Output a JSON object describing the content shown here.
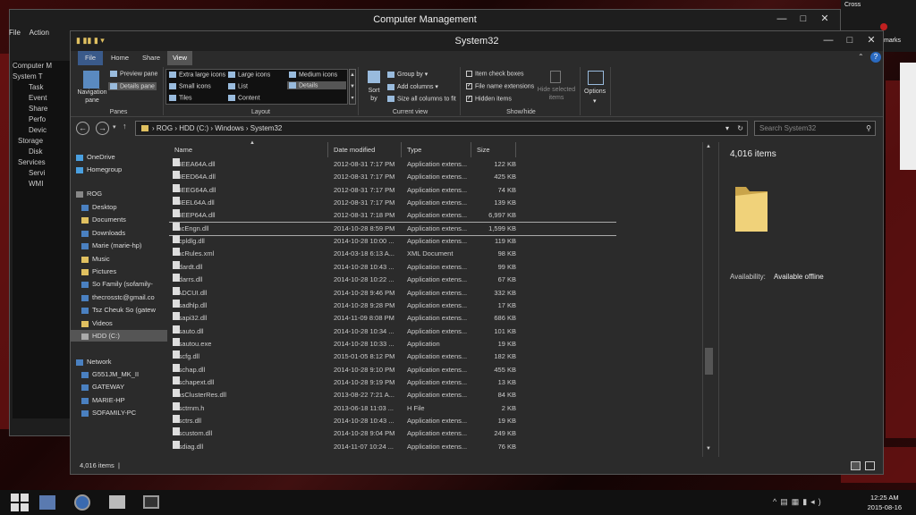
{
  "cm_window": {
    "title": "Computer Management",
    "menu": [
      "File",
      "Action"
    ],
    "tree": [
      "Computer M",
      "System T",
      "Task",
      "Event",
      "Share",
      "Perfo",
      "Devic",
      "Storage",
      "Disk",
      "Services",
      "Servi",
      "WMI"
    ]
  },
  "corner": {
    "top": "Cross",
    "bottom": "marks"
  },
  "explorer": {
    "title": "System32",
    "tabs": [
      "File",
      "Home",
      "Share",
      "View"
    ],
    "ribbon": {
      "panes": {
        "navigation_pane": "Navigation pane",
        "preview_pane": "Preview pane",
        "details_pane": "Details pane",
        "label": "Panes"
      },
      "layout": {
        "options": [
          "Extra large icons",
          "Large icons",
          "Medium icons",
          "Small icons",
          "List",
          "Details",
          "Tiles",
          "Content"
        ],
        "label": "Layout"
      },
      "current_view": {
        "sort_by": "Sort by",
        "group_by": "Group by",
        "add_columns": "Add columns",
        "size_all": "Size all columns to fit",
        "label": "Current view"
      },
      "show_hide": {
        "item_check_boxes": "Item check boxes",
        "file_name_extensions": "File name extensions",
        "hidden_items": "Hidden items",
        "hide_selected": "Hide selected items",
        "label": "Show/hide"
      },
      "options_label": "Options"
    },
    "address": {
      "crumbs": [
        "ROG",
        "HDD (C:)",
        "Windows",
        "System32"
      ],
      "search_placeholder": "Search System32"
    },
    "nav": [
      {
        "label": "OneDrive",
        "color": "#4aa0e0"
      },
      {
        "label": "Homegroup",
        "color": "#4aa0e0"
      },
      {
        "label": "ROG",
        "color": "#888"
      },
      {
        "label": "Desktop",
        "color": "#4a80c0"
      },
      {
        "label": "Documents",
        "color": "#e0c060"
      },
      {
        "label": "Downloads",
        "color": "#4a80c0"
      },
      {
        "label": "Marie (marie-hp)",
        "color": "#4a80c0"
      },
      {
        "label": "Music",
        "color": "#e0c060"
      },
      {
        "label": "Pictures",
        "color": "#e0c060"
      },
      {
        "label": "So Family (sofamily-",
        "color": "#4a80c0"
      },
      {
        "label": "thecrosstc@gmail.co",
        "color": "#4a80c0"
      },
      {
        "label": "Tsz Cheuk So (gatew",
        "color": "#4a80c0"
      },
      {
        "label": "Videos",
        "color": "#e0c060"
      },
      {
        "label": "HDD (C:)",
        "color": "#aaa"
      },
      {
        "label": "Network",
        "color": "#4a80c0"
      },
      {
        "label": "G551JM_MK_II",
        "color": "#4a80c0"
      },
      {
        "label": "GATEWAY",
        "color": "#4a80c0"
      },
      {
        "label": "MARIE-HP",
        "color": "#4a80c0"
      },
      {
        "label": "SOFAMILY-PC",
        "color": "#4a80c0"
      }
    ],
    "columns": [
      "Name",
      "Date modified",
      "Type",
      "Size"
    ],
    "files": [
      {
        "name": "R4EEA64A.dll",
        "date": "2012-08-31 7:17 PM",
        "type": "Application extens...",
        "size": "122 KB"
      },
      {
        "name": "R4EED64A.dll",
        "date": "2012-08-31 7:17 PM",
        "type": "Application extens...",
        "size": "425 KB"
      },
      {
        "name": "R4EEG64A.dll",
        "date": "2012-08-31 7:17 PM",
        "type": "Application extens...",
        "size": "74 KB"
      },
      {
        "name": "R4EEL64A.dll",
        "date": "2012-08-31 7:17 PM",
        "type": "Application extens...",
        "size": "139 KB"
      },
      {
        "name": "R4EEP64A.dll",
        "date": "2012-08-31 7:18 PM",
        "type": "Application extens...",
        "size": "6,997 KB"
      },
      {
        "name": "RacEngn.dll",
        "date": "2014-10-28 8:59 PM",
        "type": "Application extens...",
        "size": "1,599 KB"
      },
      {
        "name": "racpldlg.dll",
        "date": "2014-10-28 10:00 ...",
        "type": "Application extens...",
        "size": "119 KB"
      },
      {
        "name": "RacRules.xml",
        "date": "2014-03-18 6:13 A...",
        "type": "XML Document",
        "size": "98 KB"
      },
      {
        "name": "radardt.dll",
        "date": "2014-10-28 10:43 ...",
        "type": "Application extens...",
        "size": "99 KB"
      },
      {
        "name": "radarrs.dll",
        "date": "2014-10-28 10:22 ...",
        "type": "Application extens...",
        "size": "67 KB"
      },
      {
        "name": "RADCUI.dll",
        "date": "2014-10-28 9:46 PM",
        "type": "Application extens...",
        "size": "332 KB"
      },
      {
        "name": "rasadhlp.dll",
        "date": "2014-10-28 9:28 PM",
        "type": "Application extens...",
        "size": "17 KB"
      },
      {
        "name": "rasapi32.dll",
        "date": "2014-11-09 8:08 PM",
        "type": "Application extens...",
        "size": "686 KB"
      },
      {
        "name": "rasauto.dll",
        "date": "2014-10-28 10:34 ...",
        "type": "Application extens...",
        "size": "101 KB"
      },
      {
        "name": "rasautou.exe",
        "date": "2014-10-28 10:33 ...",
        "type": "Application",
        "size": "19 KB"
      },
      {
        "name": "rascfg.dll",
        "date": "2015-01-05 8:12 PM",
        "type": "Application extens...",
        "size": "182 KB"
      },
      {
        "name": "raschap.dll",
        "date": "2014-10-28 9:10 PM",
        "type": "Application extens...",
        "size": "455 KB"
      },
      {
        "name": "raschapext.dll",
        "date": "2014-10-28 9:19 PM",
        "type": "Application extens...",
        "size": "13 KB"
      },
      {
        "name": "RasClusterRes.dll",
        "date": "2013-08-22 7:21 A...",
        "type": "Application extens...",
        "size": "84 KB"
      },
      {
        "name": "rasctrnm.h",
        "date": "2013-06-18 11:03 ...",
        "type": "H File",
        "size": "2 KB"
      },
      {
        "name": "rasctrs.dll",
        "date": "2014-10-28 10:43 ...",
        "type": "Application extens...",
        "size": "19 KB"
      },
      {
        "name": "rascustom.dll",
        "date": "2014-10-28 9:04 PM",
        "type": "Application extens...",
        "size": "249 KB"
      },
      {
        "name": "rasdiag.dll",
        "date": "2014-11-07 10:24 ...",
        "type": "Application extens...",
        "size": "76 KB"
      }
    ],
    "details": {
      "count": "4,016 items",
      "availability_label": "Availability:",
      "availability_value": "Available offline"
    },
    "status": "4,016 items"
  },
  "clock": {
    "time": "12:25 AM",
    "date": "2015-08-16"
  }
}
